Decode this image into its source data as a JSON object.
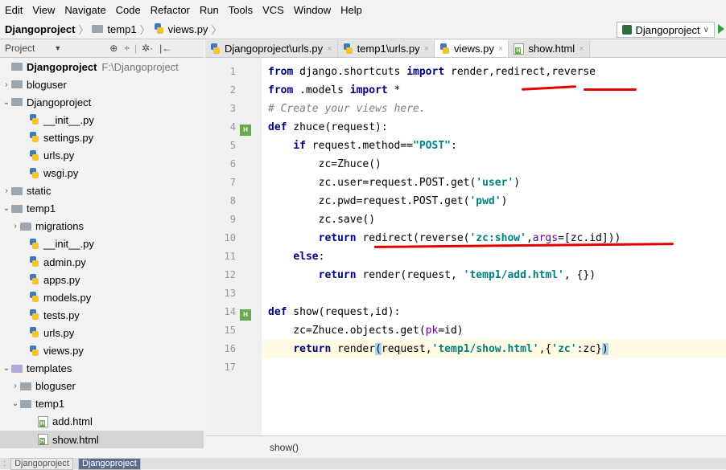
{
  "menu": [
    "Edit",
    "View",
    "Navigate",
    "Code",
    "Refactor",
    "Run",
    "Tools",
    "VCS",
    "Window",
    "Help"
  ],
  "breadcrumb": [
    "Djangoproject",
    "temp1",
    "views.py"
  ],
  "run_config": "Djangoproject",
  "project_panel": {
    "title": "Project"
  },
  "tree": [
    {
      "indent": 0,
      "arrow": "",
      "type": "folder",
      "label": "Djangoproject",
      "path": "F:\\Djangoproject",
      "bold": true
    },
    {
      "indent": 0,
      "arrow": "›",
      "type": "folder",
      "label": "bloguser"
    },
    {
      "indent": 0,
      "arrow": "⌄",
      "type": "folder",
      "label": "Djangoproject"
    },
    {
      "indent": 2,
      "arrow": "",
      "type": "py",
      "label": "__init__.py"
    },
    {
      "indent": 2,
      "arrow": "",
      "type": "py",
      "label": "settings.py"
    },
    {
      "indent": 2,
      "arrow": "",
      "type": "py",
      "label": "urls.py"
    },
    {
      "indent": 2,
      "arrow": "",
      "type": "py",
      "label": "wsgi.py"
    },
    {
      "indent": 0,
      "arrow": "›",
      "type": "folder",
      "label": "static"
    },
    {
      "indent": 0,
      "arrow": "⌄",
      "type": "folder",
      "label": "temp1"
    },
    {
      "indent": 1,
      "arrow": "›",
      "type": "folder",
      "label": "migrations"
    },
    {
      "indent": 2,
      "arrow": "",
      "type": "py",
      "label": "__init__.py"
    },
    {
      "indent": 2,
      "arrow": "",
      "type": "py",
      "label": "admin.py"
    },
    {
      "indent": 2,
      "arrow": "",
      "type": "py",
      "label": "apps.py"
    },
    {
      "indent": 2,
      "arrow": "",
      "type": "py",
      "label": "models.py"
    },
    {
      "indent": 2,
      "arrow": "",
      "type": "py",
      "label": "tests.py"
    },
    {
      "indent": 2,
      "arrow": "",
      "type": "py",
      "label": "urls.py"
    },
    {
      "indent": 2,
      "arrow": "",
      "type": "py",
      "label": "views.py"
    },
    {
      "indent": 0,
      "arrow": "⌄",
      "type": "tpl",
      "label": "templates"
    },
    {
      "indent": 1,
      "arrow": "›",
      "type": "folder",
      "label": "bloguser"
    },
    {
      "indent": 1,
      "arrow": "⌄",
      "type": "folder",
      "label": "temp1"
    },
    {
      "indent": 3,
      "arrow": "",
      "type": "html",
      "label": "add.html"
    },
    {
      "indent": 3,
      "arrow": "",
      "type": "html",
      "label": "show.html",
      "selected": true
    }
  ],
  "editor_tabs": [
    {
      "label": "Djangoproject\\urls.py",
      "active": false
    },
    {
      "label": "temp1\\urls.py",
      "active": false
    },
    {
      "label": "views.py",
      "active": true
    },
    {
      "label": "show.html",
      "active": false
    }
  ],
  "line_numbers": [
    "1",
    "2",
    "3",
    "4",
    "5",
    "6",
    "7",
    "8",
    "9",
    "10",
    "11",
    "12",
    "13",
    "14",
    "15",
    "16",
    "17"
  ],
  "code_status": "show()",
  "bottom_tabs": [
    "Djangoproject",
    "Djangoproject"
  ],
  "colors": {
    "keyword": "#000080",
    "string": "#008080",
    "comment": "#808080",
    "annotation": "#e50000"
  }
}
